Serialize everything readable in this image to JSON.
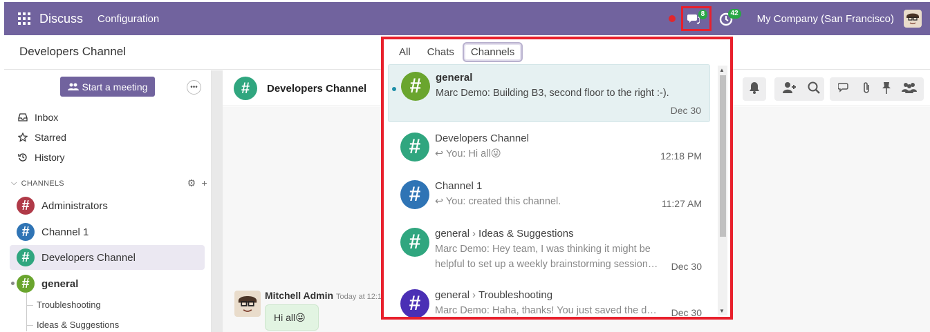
{
  "topbar": {
    "app_name": "Discuss",
    "menu_configuration": "Configuration",
    "messages_count": "8",
    "activities_count": "42",
    "company": "My Company (San Francisco)"
  },
  "breadcrumb": "Developers Channel",
  "sidebar": {
    "start_meeting": "Start a meeting",
    "nav": [
      {
        "label": "Inbox"
      },
      {
        "label": "Starred"
      },
      {
        "label": "History"
      }
    ],
    "channels_header": "CHANNELS",
    "channels": [
      {
        "label": "Administrators",
        "color": "#b03a48"
      },
      {
        "label": "Channel 1",
        "color": "#2f74b5"
      },
      {
        "label": "Developers Channel",
        "color": "#30a67f"
      },
      {
        "label": "general",
        "color": "#6aa52e"
      }
    ],
    "subchannels": [
      "Troubleshooting",
      "Ideas & Suggestions"
    ]
  },
  "thread": {
    "title": "Developers Channel",
    "message_author": "Mitchell Admin",
    "message_time": "Today at 12:1",
    "message_text": "Hi all😜"
  },
  "dropdown": {
    "tabs": [
      "All",
      "Chats",
      "Channels"
    ],
    "items": [
      {
        "name": "general",
        "parent": "",
        "preview": "Marc Demo: Building B3, second floor to the right :-).",
        "date": "Dec 30",
        "color": "#6aa52e"
      },
      {
        "name": "Developers Channel",
        "parent": "",
        "preview": "You: Hi all😜",
        "date": "12:18 PM",
        "color": "#30a67f"
      },
      {
        "name": "Channel 1",
        "parent": "",
        "preview": "You: created this channel.",
        "date": "11:27 AM",
        "color": "#2f74b5"
      },
      {
        "name": "Ideas & Suggestions",
        "parent": "general",
        "preview": "Marc Demo: Hey team, I was thinking it might be helpful to set up a weekly brainstorming session…",
        "date": "Dec 30",
        "color": "#30a67f"
      },
      {
        "name": "Troubleshooting",
        "parent": "general",
        "preview": "Marc Demo: Haha, thanks! You just saved the day!",
        "date": "Dec 30",
        "color": "#4a2fb5"
      }
    ]
  }
}
